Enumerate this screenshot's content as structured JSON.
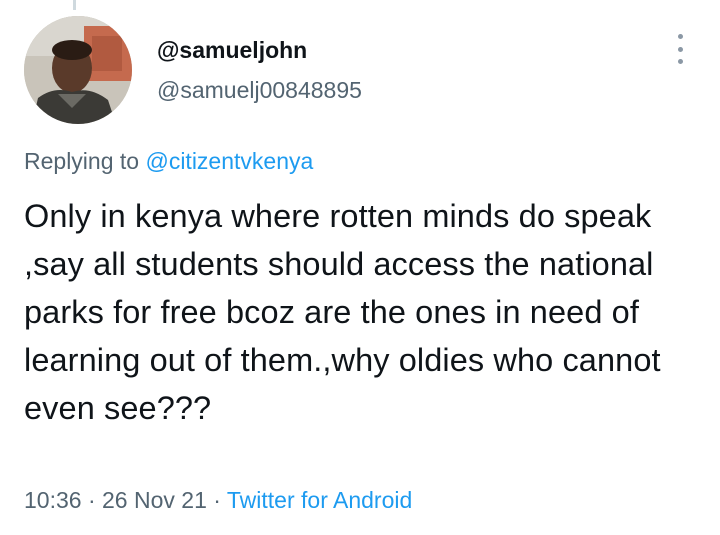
{
  "user": {
    "display_name": "@samueljohn",
    "handle": "@samuelj00848895"
  },
  "reply": {
    "prefix": "Replying to ",
    "mention": "@citizentvkenya"
  },
  "tweet": {
    "text": "Only in kenya where rotten minds do speak ,say all students should access the national parks for free bcoz are the ones in need of learning out of them.,why oldies who cannot even see???"
  },
  "meta": {
    "time": "10:36",
    "separator1": " · ",
    "date": "26 Nov 21",
    "separator2": " · ",
    "source": "Twitter for Android"
  },
  "icons": {
    "more": "more-vertical-icon",
    "avatar": "profile-photo"
  },
  "colors": {
    "text_primary": "#0f1419",
    "text_secondary": "#536471",
    "link": "#1d9bf0"
  }
}
